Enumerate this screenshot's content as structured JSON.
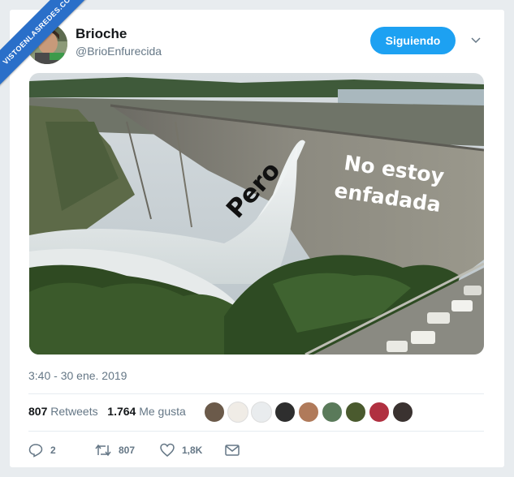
{
  "watermark": "VISTOENLASREDES.COM",
  "tweet": {
    "display_name": "Brioche",
    "handle": "@BrioEnfurecida",
    "follow_label": "Siguiendo",
    "image_text_left": "Pero",
    "image_text_right": "No estoy enfadada",
    "image_text_right_line1": "No estoy",
    "image_text_right_line2": "enfadada",
    "timestamp": "3:40 - 30 ene. 2019",
    "retweets_count": "807",
    "retweets_label": "Retweets",
    "likes_count": "1.764",
    "likes_label": "Me gusta",
    "reply_count": "2",
    "retweet_action_count": "807",
    "like_action_count": "1,8K"
  },
  "colors": {
    "accent": "#1da1f2",
    "text": "#14171a",
    "secondary": "#657786",
    "watermark_bg": "#2a6fc9"
  },
  "icons": [
    "chevron-down-icon",
    "reply-icon",
    "retweet-icon",
    "heart-icon",
    "mail-icon"
  ]
}
